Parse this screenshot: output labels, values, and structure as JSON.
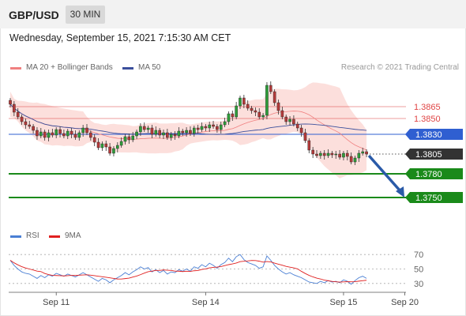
{
  "header": {
    "symbol": "GBP/USD",
    "timeframe": "30 MIN"
  },
  "timestamp": "Wednesday, September 15, 2021 7:15:30 AM CET",
  "legend": {
    "bollinger_label": "MA 20 + Bollinger Bands",
    "ma50_label": "MA 50"
  },
  "credit": "Research © 2021 Trading Central",
  "rsi_legend": {
    "rsi_label": "RSI",
    "ma_label": "9MA"
  },
  "colors": {
    "accent_blue": "#2f5fd1",
    "bollinger": "#f08080",
    "ma50": "#3b4f9c",
    "support_green": "#1a8a1a",
    "resistance_red": "#e04545",
    "candle_up": "#2e9e3a",
    "candle_down": "#b43a3a",
    "forecast_arrow": "#2a5aa8"
  },
  "chart_data": {
    "type": "candlestick",
    "ylim": [
      1.3715,
      1.3905
    ],
    "levels": [
      {
        "value": 1.3865,
        "label": "1.3865",
        "kind": "resistance"
      },
      {
        "value": 1.385,
        "label": "1.3850",
        "kind": "resistance"
      },
      {
        "value": 1.383,
        "label": "1.3830",
        "kind": "pivot"
      },
      {
        "value": 1.3805,
        "label": "1.3805",
        "kind": "last"
      },
      {
        "value": 1.378,
        "label": "1.3780",
        "kind": "support"
      },
      {
        "value": 1.375,
        "label": "1.3750",
        "kind": "support"
      }
    ],
    "closes": [
      1.3868,
      1.3858,
      1.3852,
      1.3846,
      1.3842,
      1.384,
      1.3835,
      1.3828,
      1.3833,
      1.3826,
      1.3832,
      1.3829,
      1.3836,
      1.3831,
      1.3828,
      1.3834,
      1.383,
      1.3826,
      1.3832,
      1.3838,
      1.3832,
      1.3826,
      1.382,
      1.3813,
      1.3818,
      1.3814,
      1.3806,
      1.3812,
      1.3816,
      1.3821,
      1.3827,
      1.3823,
      1.3828,
      1.3833,
      1.384,
      1.3836,
      1.3838,
      1.383,
      1.3835,
      1.3829,
      1.3832,
      1.3826,
      1.383,
      1.3828,
      1.3834,
      1.3832,
      1.3835,
      1.3831,
      1.3838,
      1.3836,
      1.384,
      1.3838,
      1.3842,
      1.384,
      1.3836,
      1.3842,
      1.3846,
      1.3856,
      1.3852,
      1.3866,
      1.3876,
      1.3868,
      1.3863,
      1.386,
      1.3858,
      1.3852,
      1.3854,
      1.3892,
      1.3884,
      1.387,
      1.386,
      1.3852,
      1.3846,
      1.3849,
      1.3843,
      1.3838,
      1.3832,
      1.3822,
      1.381,
      1.3805,
      1.3803,
      1.3806,
      1.3803,
      1.3806,
      1.3804,
      1.3805,
      1.3801,
      1.3806,
      1.3802,
      1.3795,
      1.38,
      1.3806,
      1.3808,
      1.3805
    ],
    "sep20_index": 94,
    "rsi": [
      62,
      55,
      50,
      46,
      44,
      43,
      40,
      37,
      41,
      38,
      42,
      40,
      44,
      42,
      40,
      43,
      41,
      39,
      42,
      45,
      42,
      39,
      36,
      33,
      37,
      35,
      31,
      35,
      38,
      41,
      45,
      42,
      46,
      49,
      53,
      50,
      52,
      46,
      49,
      45,
      48,
      43,
      46,
      45,
      49,
      47,
      50,
      47,
      53,
      51,
      56,
      53,
      58,
      55,
      51,
      56,
      59,
      65,
      60,
      67,
      70,
      63,
      59,
      57,
      55,
      51,
      53,
      68,
      62,
      55,
      50,
      46,
      43,
      45,
      42,
      40,
      38,
      35,
      32,
      31,
      30,
      33,
      31,
      34,
      32,
      33,
      31,
      35,
      33,
      29,
      34,
      38,
      40,
      37
    ],
    "rsi_ticks": [
      30,
      50,
      70
    ],
    "rsi_ylim": [
      20,
      80
    ],
    "x_labels": [
      {
        "label": "Sep 11",
        "index": 12
      },
      {
        "label": "Sep 14",
        "index": 51
      },
      {
        "label": "Sep 15",
        "index": 87
      },
      {
        "label": "Sep 20",
        "index": 103
      }
    ]
  }
}
